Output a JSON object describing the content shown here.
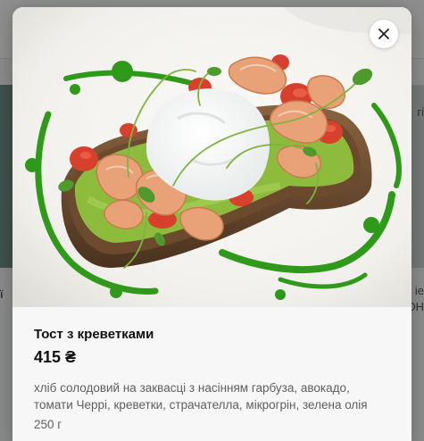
{
  "background": {
    "left_fragment": "ї",
    "right_fragment_top": "гі",
    "right_fragment_mid": "ie",
    "right_fragment_low": "ОН"
  },
  "modal": {
    "close_icon": "close-icon",
    "photo_subject": "shrimp-avocado-toast-photo",
    "title": "Тост з креветками",
    "price": "415 ₴",
    "description": "хліб солодовий на заквасці з насінням гарбуза, авокадо, томати Черрі, креветки, страчателла, мікрогрін, зелена олія",
    "weight": "250 г"
  },
  "colors": {
    "plate": "#f4f3ef",
    "herb_oil": "#2f9a1a",
    "bread_crust": "#6b4a2e",
    "avocado": "#8dbb3c",
    "shrimp": "#e9a277",
    "tomato": "#d8402e",
    "info_bg": "#f7f7f7"
  }
}
